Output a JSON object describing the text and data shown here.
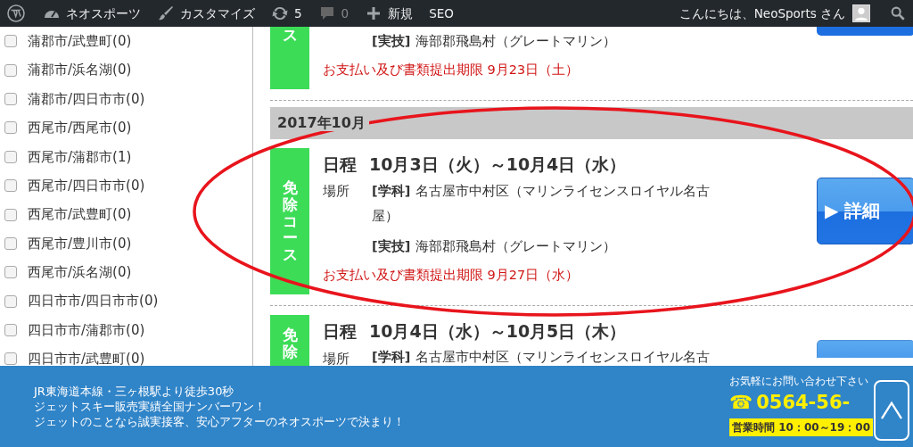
{
  "admin_bar": {
    "left": [
      {
        "muted": false
      },
      {
        "label": "ネオスポーツ",
        "muted": false
      },
      {
        "label": "カスタマイズ",
        "muted": false
      },
      {
        "label": "5",
        "muted": false
      },
      {
        "label": "0",
        "muted": true
      },
      {
        "label": "新規",
        "muted": false
      },
      {
        "label": "SEO",
        "muted": false
      }
    ],
    "greeting": "こんにちは、NeoSports さん"
  },
  "sidebar": {
    "filters": [
      {
        "label": "蒲郡市/武豊町(0)",
        "checked": false
      },
      {
        "label": "蒲郡市/浜名湖(0)",
        "checked": false
      },
      {
        "label": "蒲郡市/四日市市(0)",
        "checked": false
      },
      {
        "label": "西尾市/西尾市(0)",
        "checked": false
      },
      {
        "label": "西尾市/蒲郡市(1)",
        "checked": false
      },
      {
        "label": "西尾市/四日市市(0)",
        "checked": false
      },
      {
        "label": "西尾市/武豊町(0)",
        "checked": false
      },
      {
        "label": "西尾市/豊川市(0)",
        "checked": false
      },
      {
        "label": "西尾市/浜名湖(0)",
        "checked": false
      },
      {
        "label": "四日市市/四日市市(0)",
        "checked": false
      },
      {
        "label": "四日市市/蒲郡市(0)",
        "checked": false
      },
      {
        "label": "四日市市/武豊町(0)",
        "checked": false
      }
    ]
  },
  "schedule": [
    {
      "kind": "course_end",
      "tag": "ス",
      "places": [
        {
          "tag": "[実技]",
          "text": "海部郡飛島村（グレートマリン）"
        }
      ],
      "deadline": "お支払い及び書類提出期限 9月23日（土）"
    },
    {
      "kind": "month",
      "label": "2017年10月"
    },
    {
      "kind": "course",
      "tag": "免除コース",
      "date_label": "日程",
      "dates": "10月3日（火）～10月4日（水）",
      "place_label": "場所",
      "places": [
        {
          "tag": "[学科]",
          "text": "名古屋市中村区（マリンライセンスロイヤル名古屋）"
        },
        {
          "tag": "[実技]",
          "text": "海部郡飛島村（グレートマリン）"
        }
      ],
      "deadline": "お支払い及び書類提出期限 9月27日（水）",
      "button": "▶ 詳細"
    },
    {
      "kind": "course_start",
      "tag": "免除",
      "date_label": "日程",
      "dates": "10月4日（水）～10月5日（木）",
      "place_label": "場所",
      "places": [
        {
          "tag": "[学科]",
          "text": "名古屋市中村区（マリンライセンスロイヤル名古"
        }
      ]
    }
  ],
  "footer_banner": {
    "lines": [
      "JR東海道本線・三ヶ根駅より徒歩30秒",
      "ジェットスキー販売実績全国ナンバーワン！",
      "ジェットのことなら誠実接客、安心アフターのネオスポーツで決まり！"
    ],
    "contact_lead": "お気軽にお問い合わせ下さい",
    "phone_icon": "☎",
    "phone": "0564-56-",
    "hours": "営業時間 10：00～19：00"
  }
}
